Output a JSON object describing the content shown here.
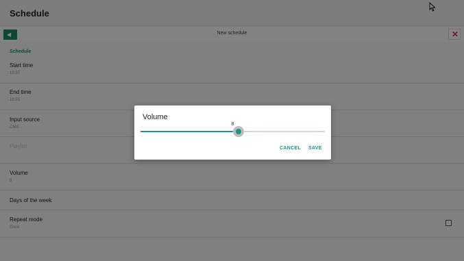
{
  "app": {
    "title": "Schedule"
  },
  "toolbar": {
    "title": "New schedule",
    "back_icon": "back-icon",
    "close_icon": "close-icon",
    "close_glyph": "✕"
  },
  "section": {
    "header": "Schedule"
  },
  "rows": [
    {
      "label": "Start time",
      "value": "10:37"
    },
    {
      "label": "End time",
      "value": "10:51"
    },
    {
      "label": "Input source",
      "value": "CMS"
    },
    {
      "label": "Playlist",
      "value": ""
    },
    {
      "label": "Volume",
      "value": "0"
    },
    {
      "label": "Days of the week",
      "value": ""
    },
    {
      "label": "Repeat mode",
      "value": "Once"
    }
  ],
  "dialog": {
    "title": "Volume",
    "slider": {
      "value": "8",
      "fraction": 0.53
    },
    "cancel_label": "CANCEL",
    "save_label": "SAVE"
  },
  "colors": {
    "accent": "#159688",
    "close": "#d32f2f",
    "back": "#1e8a5a"
  }
}
